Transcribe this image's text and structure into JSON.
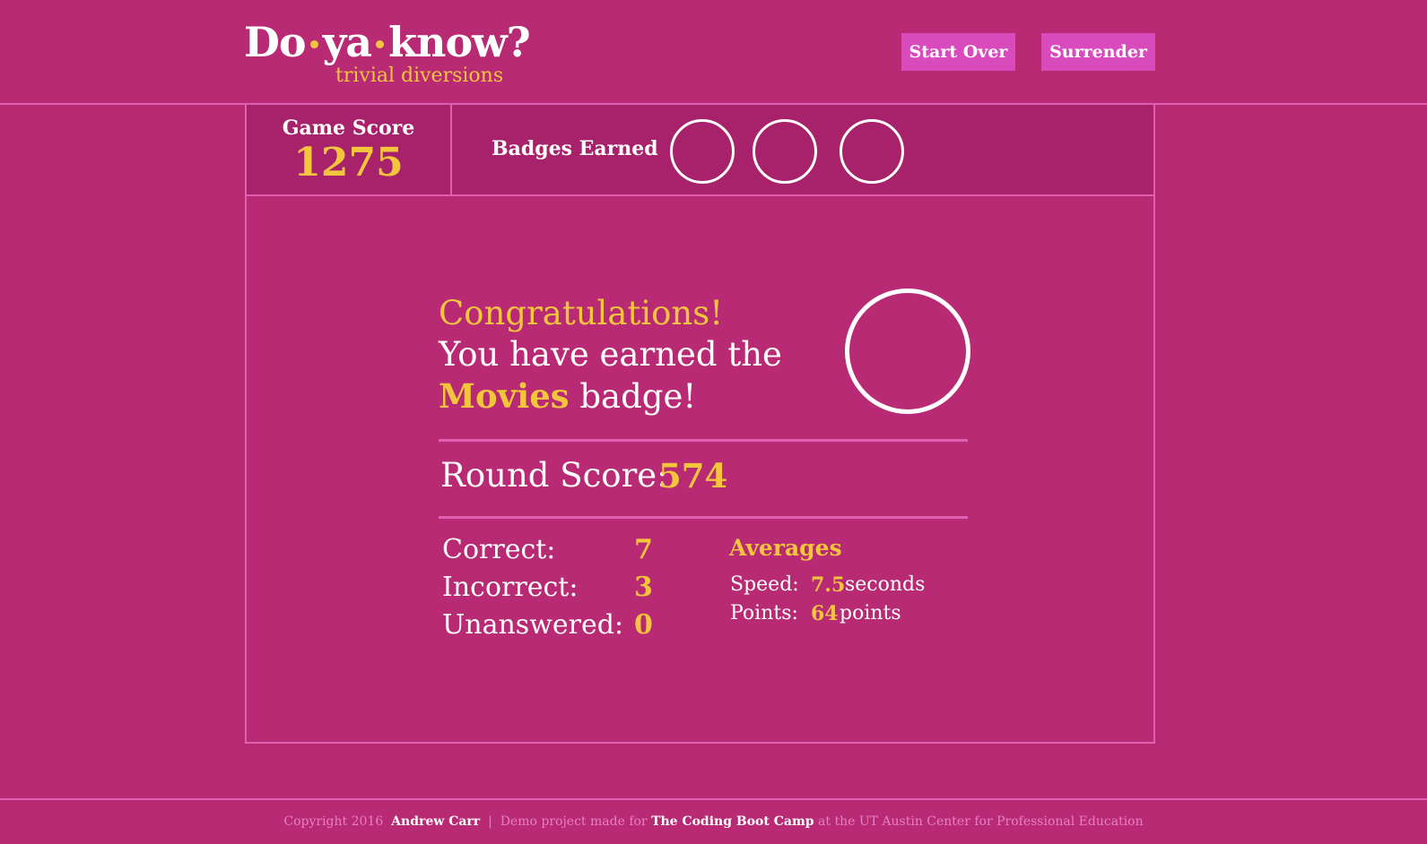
{
  "header": {
    "logo_word1": "Do",
    "logo_word2": "ya",
    "logo_word3": "know?",
    "logo_tagline": "trivial diversions",
    "start_over_label": "Start Over",
    "surrender_label": "Surrender"
  },
  "scorebar": {
    "game_score_label": "Game Score",
    "game_score_value": "1275",
    "badges_label": "Badges Earned",
    "badge_slots": 3
  },
  "result": {
    "congrats_title": "Congratulations!",
    "line1": "You have earned the",
    "badge_name": "Movies",
    "line2_suffix": " badge!",
    "round_score_label": "Round Score:",
    "round_score_value": "574",
    "stats": [
      {
        "label": "Correct:",
        "value": "7"
      },
      {
        "label": "Incorrect:",
        "value": "3"
      },
      {
        "label": "Unanswered:",
        "value": "0"
      }
    ],
    "averages": {
      "title": "Averages",
      "speed_label": "Speed:",
      "speed_value": "7.5",
      "speed_unit": "seconds",
      "points_label": "Points:",
      "points_value": "64",
      "points_unit": "points"
    }
  },
  "footer": {
    "copyright": "Copyright 2016",
    "author": "Andrew Carr",
    "separator": "|",
    "demo_text": "Demo project made for",
    "bootcamp": "The Coding Boot Camp",
    "suffix": "at the UT Austin Center for Professional Education"
  },
  "colors": {
    "background": "#b82a74",
    "panel": "#a7226a",
    "accent": "#f2c53d",
    "button": "#d94bbd",
    "rule": "#e05fb0"
  }
}
